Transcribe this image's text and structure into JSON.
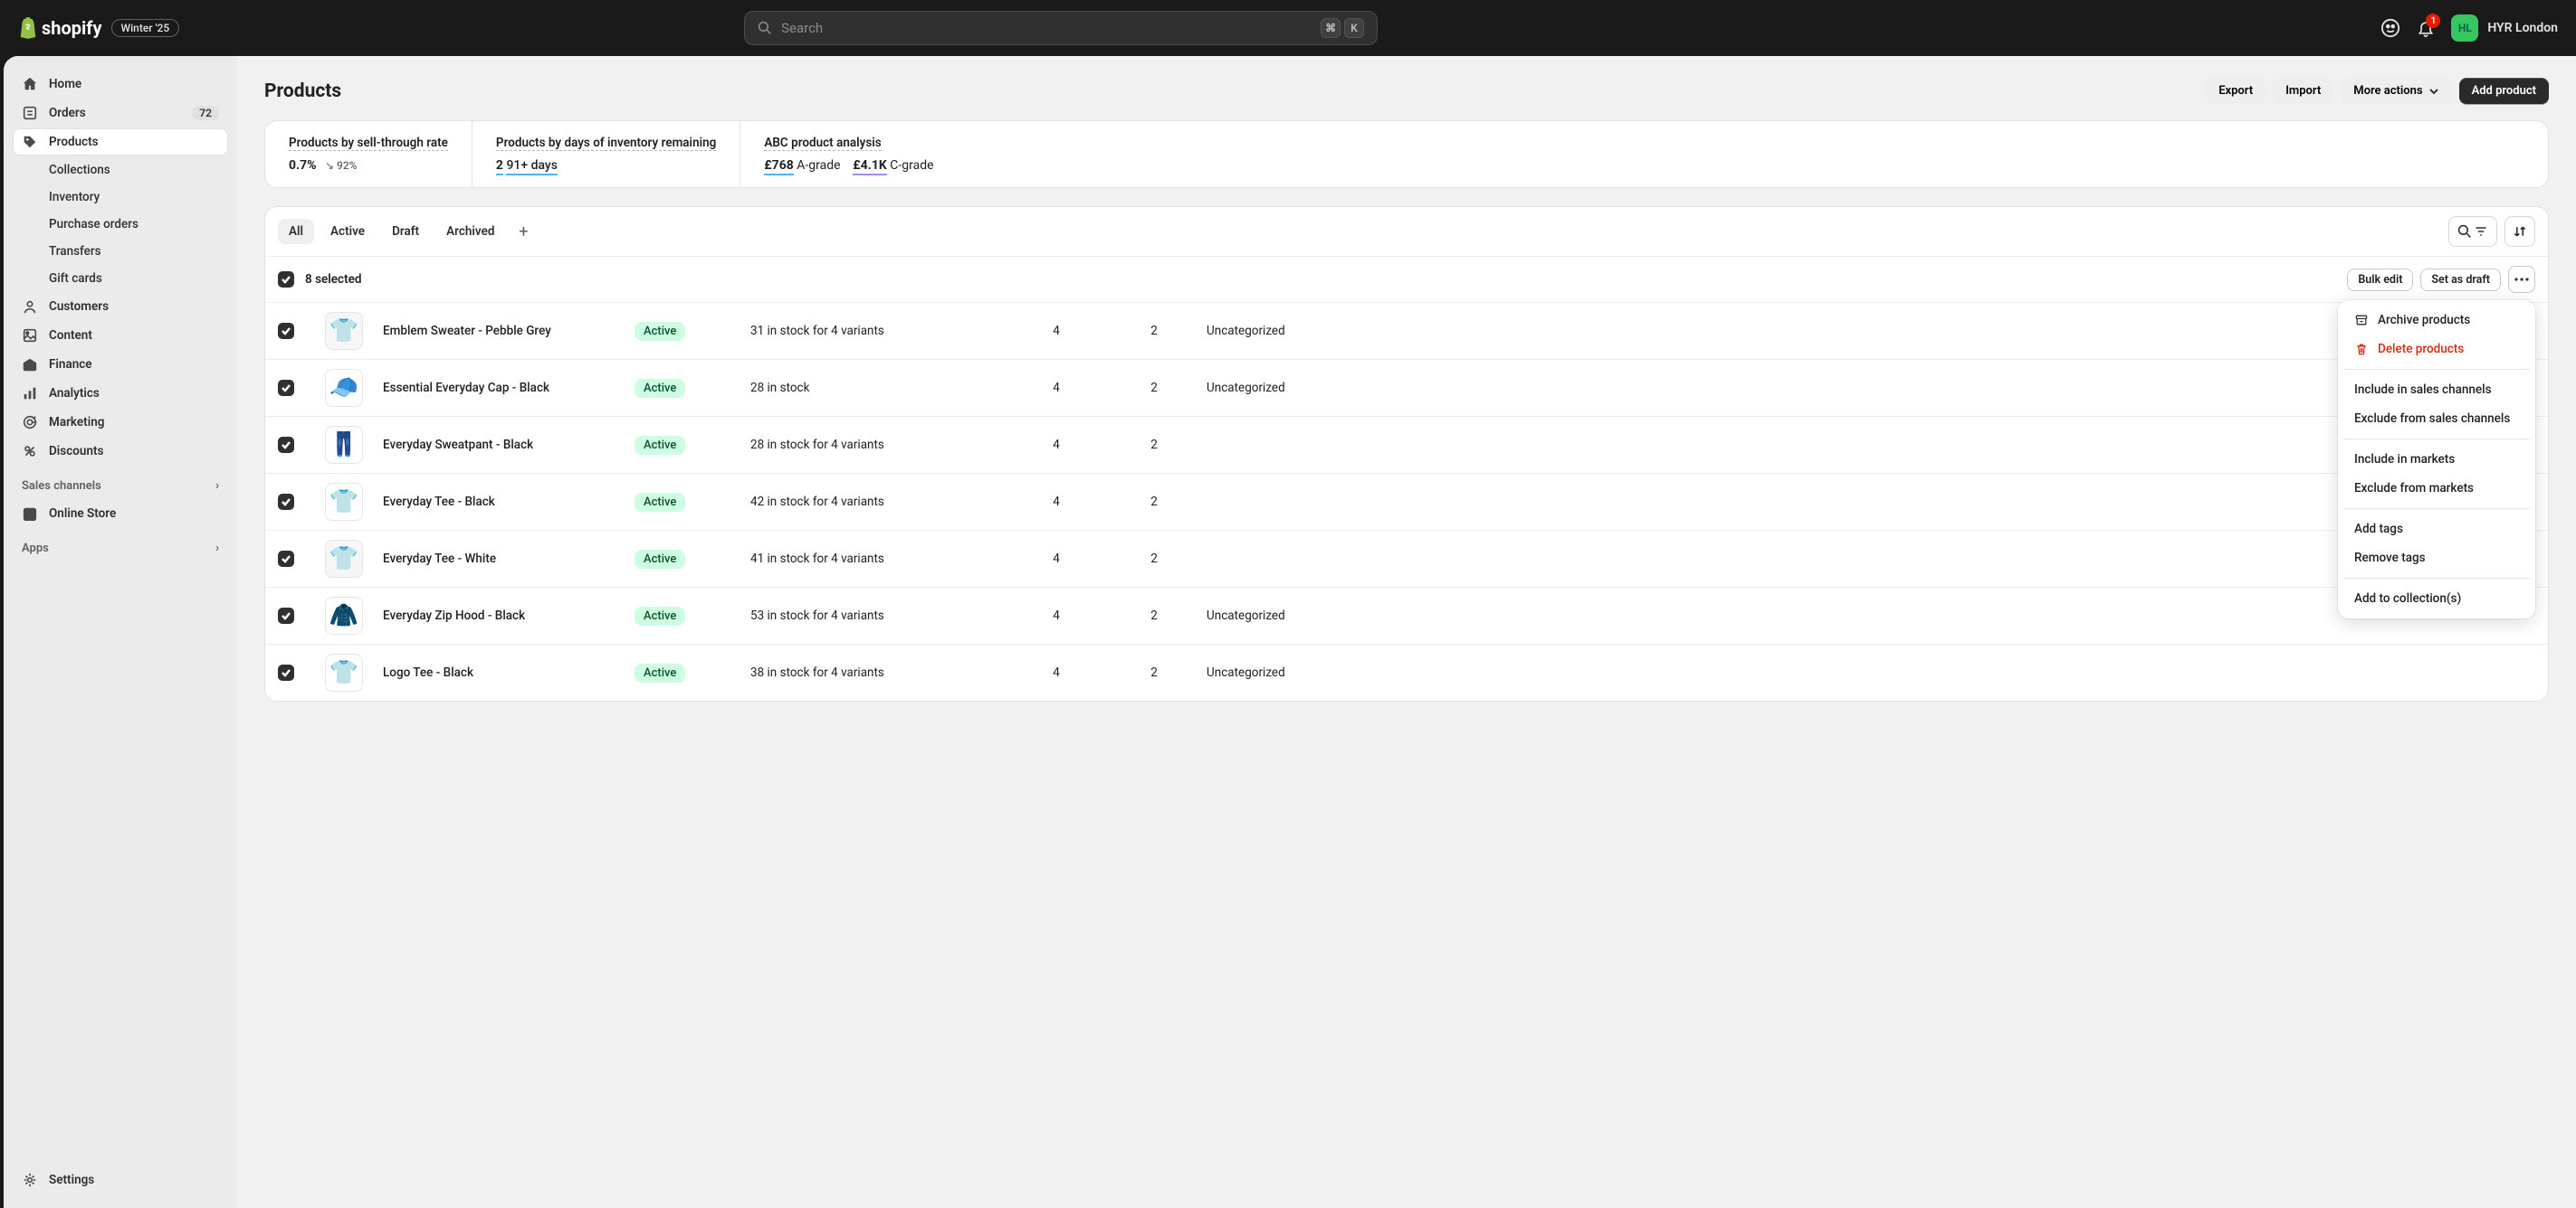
{
  "topbar": {
    "logo_text": "shopify",
    "edition": "Winter '25",
    "search_placeholder": "Search",
    "kbd1": "⌘",
    "kbd2": "K",
    "notif_count": "1",
    "avatar_initials": "HL",
    "account_name": "HYR London"
  },
  "sidebar": {
    "home": "Home",
    "orders": "Orders",
    "orders_badge": "72",
    "products": "Products",
    "sub_collections": "Collections",
    "sub_inventory": "Inventory",
    "sub_purchase": "Purchase orders",
    "sub_transfers": "Transfers",
    "sub_giftcards": "Gift cards",
    "customers": "Customers",
    "content": "Content",
    "finance": "Finance",
    "analytics": "Analytics",
    "marketing": "Marketing",
    "discounts": "Discounts",
    "sales_channels_header": "Sales channels",
    "online_store": "Online Store",
    "apps_header": "Apps",
    "settings": "Settings"
  },
  "page": {
    "title": "Products",
    "export": "Export",
    "import": "Import",
    "more_actions": "More actions",
    "add_product": "Add product"
  },
  "analytics": {
    "sellthrough_label": "Products by sell-through rate",
    "sellthrough_value": "0.7%",
    "sellthrough_trend": "↘ 92%",
    "inventory_label": "Products by days of inventory remaining",
    "inventory_value_num": "2",
    "inventory_value_text": "91+ days",
    "abc_label": "ABC product analysis",
    "abc_a_value": "£768",
    "abc_a_text": "A-grade",
    "abc_c_value": "£4.1K",
    "abc_c_text": "C-grade"
  },
  "tabs": {
    "all": "All",
    "active": "Active",
    "draft": "Draft",
    "archived": "Archived"
  },
  "bulk": {
    "selected_text": "8 selected",
    "bulk_edit": "Bulk edit",
    "set_draft": "Set as draft"
  },
  "popover": {
    "archive": "Archive products",
    "delete": "Delete products",
    "include_sales": "Include in sales channels",
    "exclude_sales": "Exclude from sales channels",
    "include_markets": "Include in markets",
    "exclude_markets": "Exclude from markets",
    "add_tags": "Add tags",
    "remove_tags": "Remove tags",
    "add_collections": "Add to collection(s)"
  },
  "status_label": "Active",
  "rows": [
    {
      "name": "Emblem Sweater - Pebble Grey",
      "inventory": "31 in stock for 4 variants",
      "col5": "4",
      "col6": "2",
      "category": "Uncategorized",
      "thumb_color": "#d0d0d0",
      "glyph": "👕"
    },
    {
      "name": "Essential Everyday Cap - Black",
      "inventory": "28 in stock",
      "col5": "4",
      "col6": "2",
      "category": "Uncategorized",
      "thumb_color": "#1a1a1a",
      "glyph": "🧢"
    },
    {
      "name": "Everyday Sweatpant - Black",
      "inventory": "28 in stock for 4 variants",
      "col5": "4",
      "col6": "2",
      "category": "",
      "thumb_color": "#1a1a1a",
      "glyph": "👖"
    },
    {
      "name": "Everyday Tee - Black",
      "inventory": "42 in stock for 4 variants",
      "col5": "4",
      "col6": "2",
      "category": "",
      "thumb_color": "#1a1a1a",
      "glyph": "👕"
    },
    {
      "name": "Everyday Tee - White",
      "inventory": "41 in stock for 4 variants",
      "col5": "4",
      "col6": "2",
      "category": "",
      "thumb_color": "#f5f5f5",
      "glyph": "👕"
    },
    {
      "name": "Everyday Zip Hood - Black",
      "inventory": "53 in stock for 4 variants",
      "col5": "4",
      "col6": "2",
      "category": "Uncategorized",
      "thumb_color": "#1a1a1a",
      "glyph": "🧥"
    },
    {
      "name": "Logo Tee - Black",
      "inventory": "38 in stock for 4 variants",
      "col5": "4",
      "col6": "2",
      "category": "Uncategorized",
      "thumb_color": "#1a1a1a",
      "glyph": "👕"
    }
  ]
}
